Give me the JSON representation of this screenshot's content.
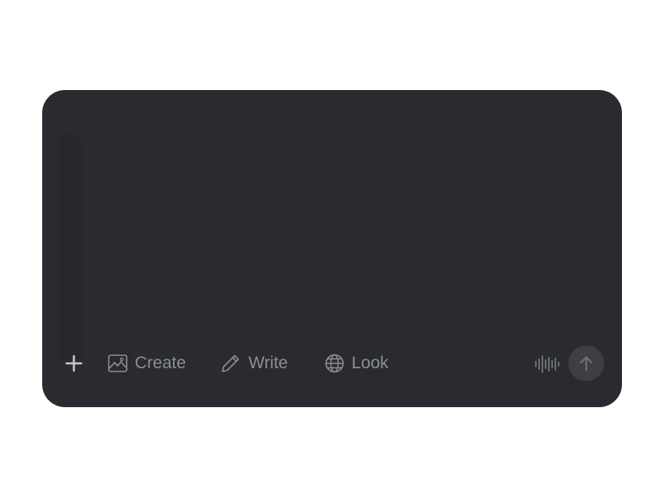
{
  "composer": {
    "input": {
      "value": ""
    },
    "toolbar": {
      "add_icon": "plus-icon",
      "chips": [
        {
          "label": "Create",
          "icon": "image-icon"
        },
        {
          "label": "Write",
          "icon": "pencil-icon"
        },
        {
          "label": "Look",
          "icon": "globe-icon"
        }
      ],
      "voice_icon": "waveform-icon",
      "send_icon": "arrow-up-icon"
    }
  },
  "colors": {
    "page_background": "#ffffff",
    "composer_background": "#2a2b30",
    "chip_text": "#8d8f97",
    "send_button_background": "#3e3f45",
    "icon_light": "#c6c7cd"
  }
}
